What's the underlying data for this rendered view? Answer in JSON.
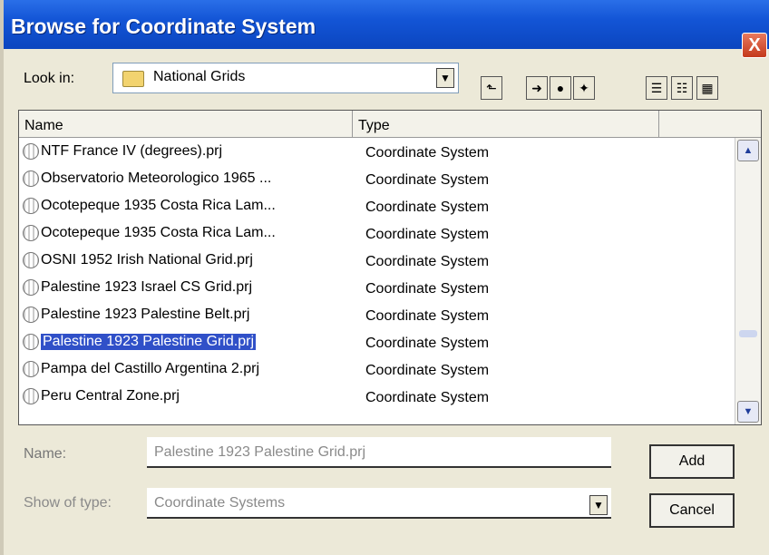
{
  "window": {
    "title": "Browse for Coordinate System",
    "close_label": "X"
  },
  "look_in": {
    "label": "Look in:",
    "value": "National Grids"
  },
  "toolbar": {
    "up_icon": "folder-up-icon",
    "view_icons": [
      "connect-icon",
      "disconnect-icon",
      "new-folder-icon",
      "list-view-icon",
      "details-view-icon",
      "large-icons-view-icon"
    ]
  },
  "list": {
    "columns": [
      "Name",
      "Type"
    ],
    "rows": [
      {
        "name": "NTF France IV (degrees).prj",
        "type": "Coordinate System"
      },
      {
        "name": "Observatorio Meteorologico 1965 ...",
        "type": "Coordinate System"
      },
      {
        "name": "Ocotepeque 1935 Costa Rica Lam...",
        "type": "Coordinate System"
      },
      {
        "name": "Ocotepeque 1935 Costa Rica Lam...",
        "type": "Coordinate System"
      },
      {
        "name": "OSNI 1952 Irish National Grid.prj",
        "type": "Coordinate System"
      },
      {
        "name": "Palestine 1923 Israel CS Grid.prj",
        "type": "Coordinate System"
      },
      {
        "name": "Palestine 1923 Palestine Belt.prj",
        "type": "Coordinate System"
      },
      {
        "name": "Palestine 1923 Palestine Grid.prj",
        "type": "Coordinate System",
        "selected": true
      },
      {
        "name": "Pampa del Castillo Argentina 2.prj",
        "type": "Coordinate System"
      },
      {
        "name": "Peru Central Zone.prj",
        "type": "Coordinate System"
      }
    ]
  },
  "name_field": {
    "label": "Name:",
    "value": "Palestine 1923 Palestine Grid.prj"
  },
  "type_field": {
    "label": "Show of type:",
    "value": "Coordinate Systems"
  },
  "buttons": {
    "add": "Add",
    "cancel": "Cancel"
  },
  "colors": {
    "titlebar": "#1355d6",
    "selection": "#3050c8",
    "face": "#ece9d8"
  }
}
